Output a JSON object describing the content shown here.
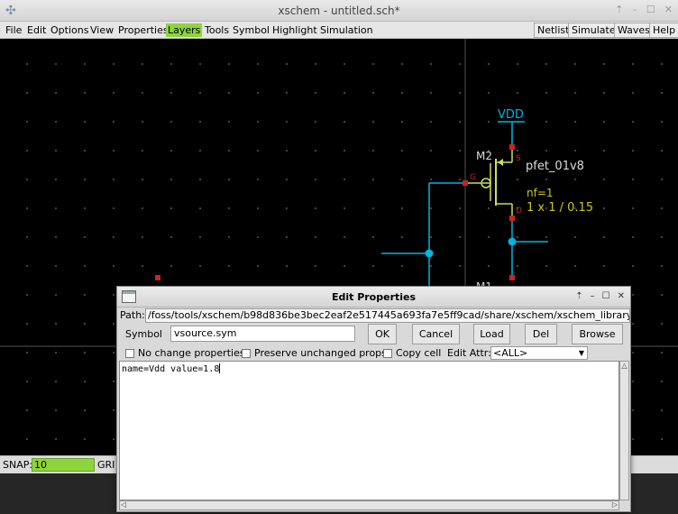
{
  "window": {
    "title": "xschem - untitled.sch*",
    "controls": [
      "⇡",
      "–",
      "☐",
      "✕"
    ]
  },
  "menubar": {
    "items": [
      "File",
      "Edit",
      "Options",
      "View",
      "Properties",
      "Layers",
      "Tools",
      "Symbol",
      "Highlight",
      "Simulation"
    ],
    "active_item": "Layers",
    "right_buttons": [
      "Netlist",
      "Simulate",
      "Waves",
      "Help"
    ]
  },
  "schematic": {
    "vdd_label": "VDD",
    "m2_label": "M2",
    "m2_model": "pfet_01v8",
    "m2_nf": "nf=1",
    "m2_size": "1 x 1 / 0.15",
    "pin_s": "S",
    "pin_g": "G",
    "pin_d": "D",
    "m1_label": "M1",
    "colors": {
      "wire": "#00b4e0",
      "pin": "#cc2222",
      "symbol": "#c8e060",
      "attr": "#c8c820",
      "text": "#dcdcdc"
    }
  },
  "statusbar": {
    "snap_label": "SNAP:",
    "snap_value": "10",
    "grid_label": "GRI"
  },
  "dialog": {
    "title": "Edit Properties",
    "path_label": "Path:",
    "path_value": "/foss/tools/xschem/b98d836be3bec2eaf2e517445a693fa7e5ff9cad/share/xschem/xschem_library/devices",
    "symbol_label": "Symbol",
    "symbol_value": "vsource.sym",
    "buttons": [
      "OK",
      "Cancel",
      "Load",
      "Del",
      "Browse"
    ],
    "checkboxes": [
      "No change properties",
      "Preserve unchanged props",
      "Copy cell"
    ],
    "edit_attr_label": "Edit Attr:",
    "edit_attr_value": "<ALL>",
    "text_content": "name=Vdd value=1.8",
    "controls": [
      "⇡",
      "–",
      "☐",
      "✕"
    ]
  }
}
